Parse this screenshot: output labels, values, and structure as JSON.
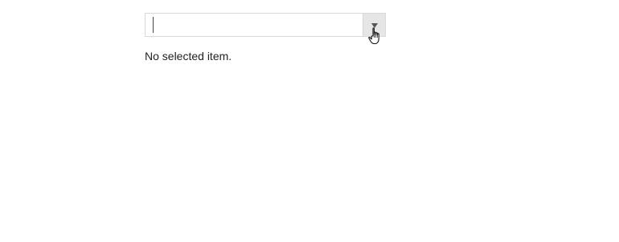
{
  "combo": {
    "value": "",
    "placeholder": ""
  },
  "status": {
    "text": "No selected item."
  },
  "icons": {
    "dropdown": "triangle-down-icon",
    "pointer": "hand-pointer-cursor"
  }
}
